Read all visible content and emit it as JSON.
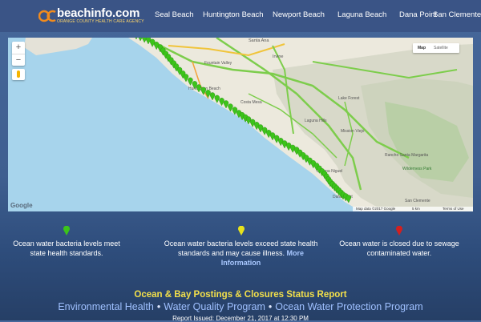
{
  "brand": {
    "name": "beachinfo.com",
    "tagline": "ORANGE COUNTY HEALTH CARE AGENCY"
  },
  "nav": {
    "items": [
      {
        "label": "Seal Beach"
      },
      {
        "label": "Huntington Beach"
      },
      {
        "label": "Newport Beach"
      },
      {
        "label": "Laguna Beach"
      },
      {
        "label": "Dana Point"
      },
      {
        "label": "San Clemente"
      }
    ]
  },
  "map": {
    "zoom_in": "+",
    "zoom_out": "−",
    "type_map": "Map",
    "type_satellite": "Satellite",
    "google": "Google",
    "footer_data": "Map data ©2017 Google",
    "footer_scale": "5 km",
    "footer_terms": "Terms of Use",
    "places": [
      "Santa Ana",
      "Irvine",
      "Fountain Valley",
      "Costa Mesa",
      "Huntington Beach",
      "Lake Forest",
      "Mission Viejo",
      "Laguna Hills",
      "Laguna Niguel",
      "Dana Point",
      "San Clemente",
      "Rancho Santa Margarita",
      "Wilderness Park"
    ],
    "pin_color_green": "#3cc41a",
    "pin_color_yellow": "#e6e21c",
    "pin_color_red": "#d22020"
  },
  "legend": {
    "green_text": "Ocean water bacteria levels meet state health standards.",
    "yellow_text": "Ocean water bacteria levels exceed state health standards and may cause illness.",
    "yellow_link": "More Information",
    "red_text": "Ocean water is closed due to sewage contaminated water."
  },
  "report": {
    "title": "Ocean & Bay Postings & Closures Status Report",
    "program_1": "Environmental Health",
    "program_2": "Water Quality Program",
    "program_3": "Ocean Water Protection Program",
    "separator": "•",
    "issued": "Report Issued:  December 21, 2017 at 12:30 PM"
  }
}
